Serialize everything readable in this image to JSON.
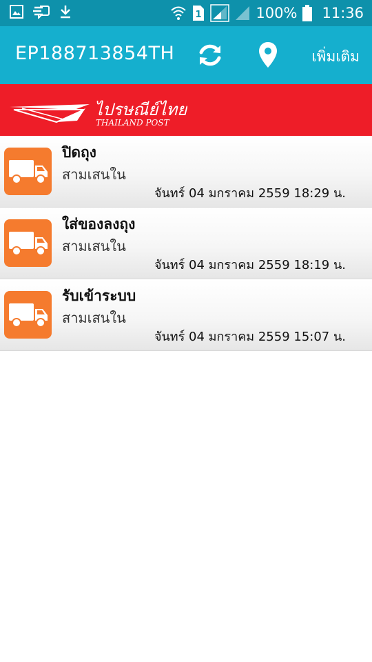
{
  "status_bar": {
    "battery_percent": "100%",
    "time": "11:36",
    "sim_slot": "1",
    "icons": [
      "gallery-icon",
      "message-icon",
      "download-icon",
      "wifi-icon",
      "sim-icon",
      "signal-icon",
      "battery-icon"
    ]
  },
  "toolbar": {
    "tracking_number": "EP188713854TH",
    "more_label": "เพิ่มเติม",
    "refresh_icon": "refresh-icon",
    "location_icon": "location-pin-icon"
  },
  "brand": {
    "logo_thai": "ไปรษณีย์ไทย",
    "logo_english": "THAILAND POST",
    "banner_color": "#ee1d28"
  },
  "colors": {
    "status_bar": "#0e91ab",
    "toolbar": "#15afce",
    "icon_tile": "#f57b2e"
  },
  "events": [
    {
      "status": "ปิดถุง",
      "location": "สามเสนใน",
      "datetime": "จันทร์ 04 มกราคม 2559 18:29 น.",
      "icon": "truck-icon"
    },
    {
      "status": "ใส่ของลงถุง",
      "location": "สามเสนใน",
      "datetime": "จันทร์ 04 มกราคม 2559 18:19 น.",
      "icon": "truck-icon"
    },
    {
      "status": "รับเข้าระบบ",
      "location": "สามเสนใน",
      "datetime": "จันทร์ 04 มกราคม 2559 15:07 น.",
      "icon": "truck-icon"
    }
  ]
}
